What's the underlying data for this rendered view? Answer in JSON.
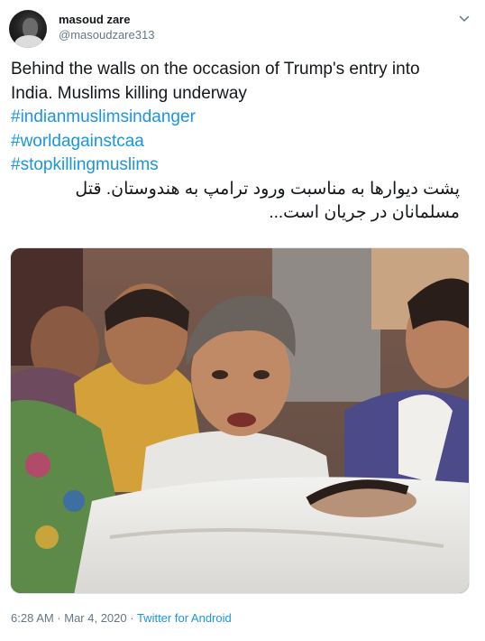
{
  "author": {
    "display_name": "masoud zare",
    "handle": "@masoudzare313"
  },
  "tweet": {
    "text_line1": "Behind the walls on the occasion of Trump's entry into",
    "text_line2": "India.  Muslims killing underway",
    "hashtags": [
      "#indianmuslimsindanger",
      "#worldagainstcaa",
      "#stopkillingmuslims"
    ],
    "persian_line1": "پشت دیوارها به مناسبت ورود ترامپ به هندوستان.  قتل",
    "persian_line2": "مسلمانان در جریان است..."
  },
  "meta": {
    "time_date": "6:28 AM · Mar 4, 2020 · ",
    "source": "Twitter for Android"
  },
  "icons": {
    "menu": "chevron-down-icon"
  }
}
